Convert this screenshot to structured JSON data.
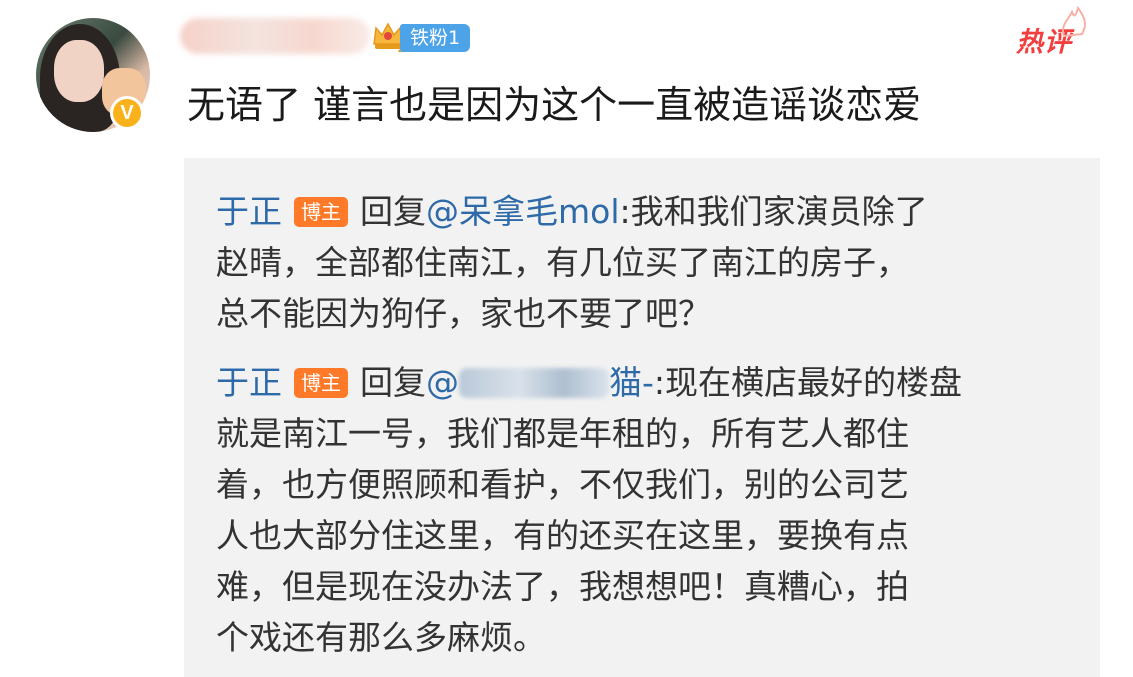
{
  "comment": {
    "fan_badge": "铁粉1",
    "crown_level": "2",
    "verified_mark": "V",
    "hot_label": "热评",
    "text": "无语了 谨言也是因为这个一直被造谣谈恋爱"
  },
  "replies": [
    {
      "author": "于正",
      "badge": "博主",
      "reply_prefix": "回复",
      "mention": "@呆拿毛mol",
      "lines": [
        ":我和我们家演员除了",
        "赵晴，全部都住南江，有几位买了南江的房子，",
        "总不能因为狗仔，家也不要了吧？"
      ]
    },
    {
      "author": "于正",
      "badge": "博主",
      "reply_prefix": "回复",
      "mention_start": "@",
      "mention_end": "猫-",
      "lines": [
        ":现在横店最好的楼盘",
        "就是南江一号，我们都是年租的，所有艺人都住",
        "着，也方便照顾和看护，不仅我们，别的公司艺",
        "人也大部分住这里，有的还买在这里，要换有点",
        "难，但是现在没办法了，我想想吧！真糟心，拍",
        "个戏还有那么多麻烦。"
      ]
    }
  ],
  "colors": {
    "author_link": "#2e6aa8",
    "host_badge": "#ff7a28",
    "fan_badge": "#4da3e8",
    "hot_label": "#f13f3f",
    "verified": "#f9b21a",
    "reply_background": "#f2f2f2"
  }
}
